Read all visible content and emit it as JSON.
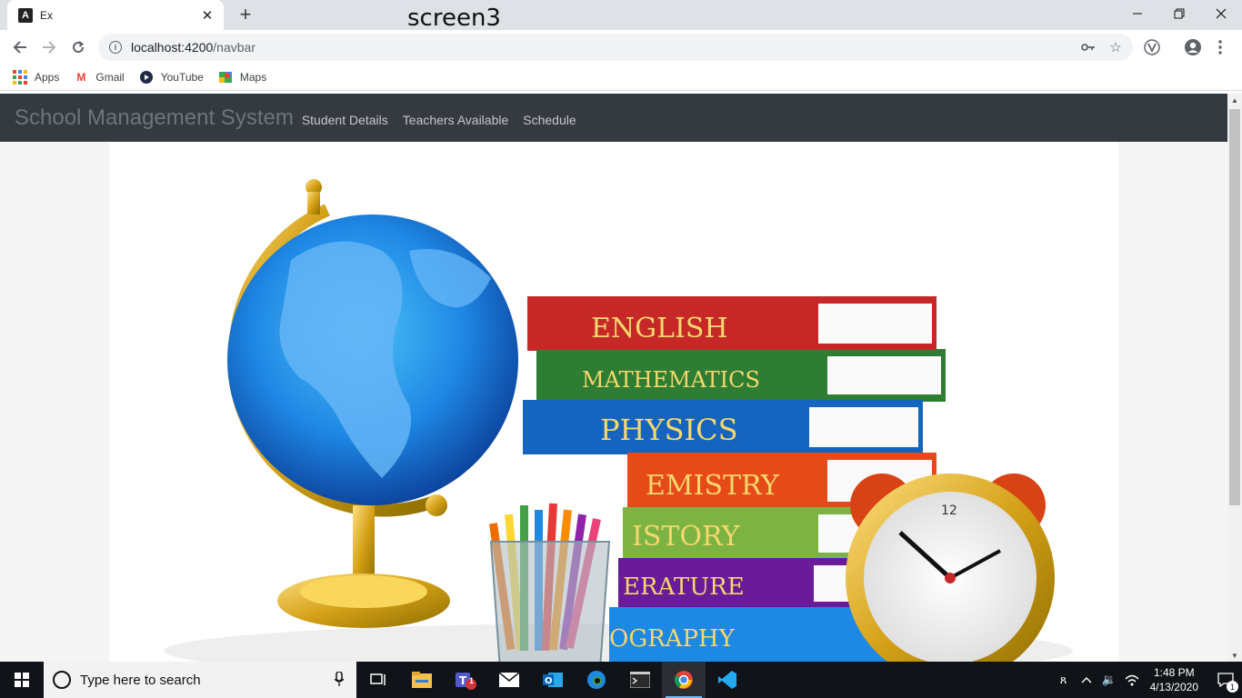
{
  "browser": {
    "tab_title": "Ex",
    "overlay_label": "screen3",
    "url_host": "localhost:4200",
    "url_path": "/navbar",
    "bookmarks": [
      {
        "label": "Apps",
        "icon": "apps-grid-icon"
      },
      {
        "label": "Gmail",
        "icon": "gmail-icon"
      },
      {
        "label": "YouTube",
        "icon": "youtube-icon"
      },
      {
        "label": "Maps",
        "icon": "maps-icon"
      }
    ]
  },
  "app": {
    "brand": "School Management System",
    "nav_links": [
      "Student Details",
      "Teachers Available",
      "Schedule"
    ],
    "hero_image": {
      "book_spines": [
        "ENGLISH",
        "MATHEMATICS",
        "PHYSICS",
        "EMISTRY",
        "ISTORY",
        "ERATURE",
        "OGRAPHY"
      ]
    }
  },
  "taskbar": {
    "search_placeholder": "Type here to search",
    "teams_badge": "1",
    "time": "1:48 PM",
    "date": "4/13/2020",
    "notification_count": "1"
  },
  "colors": {
    "navbar_bg": "#343a40",
    "brand_text": "#6c757d",
    "nav_link_text": "#c5c8cb",
    "tabstrip_bg": "#dee1e6",
    "taskbar_bg": "#101317"
  }
}
